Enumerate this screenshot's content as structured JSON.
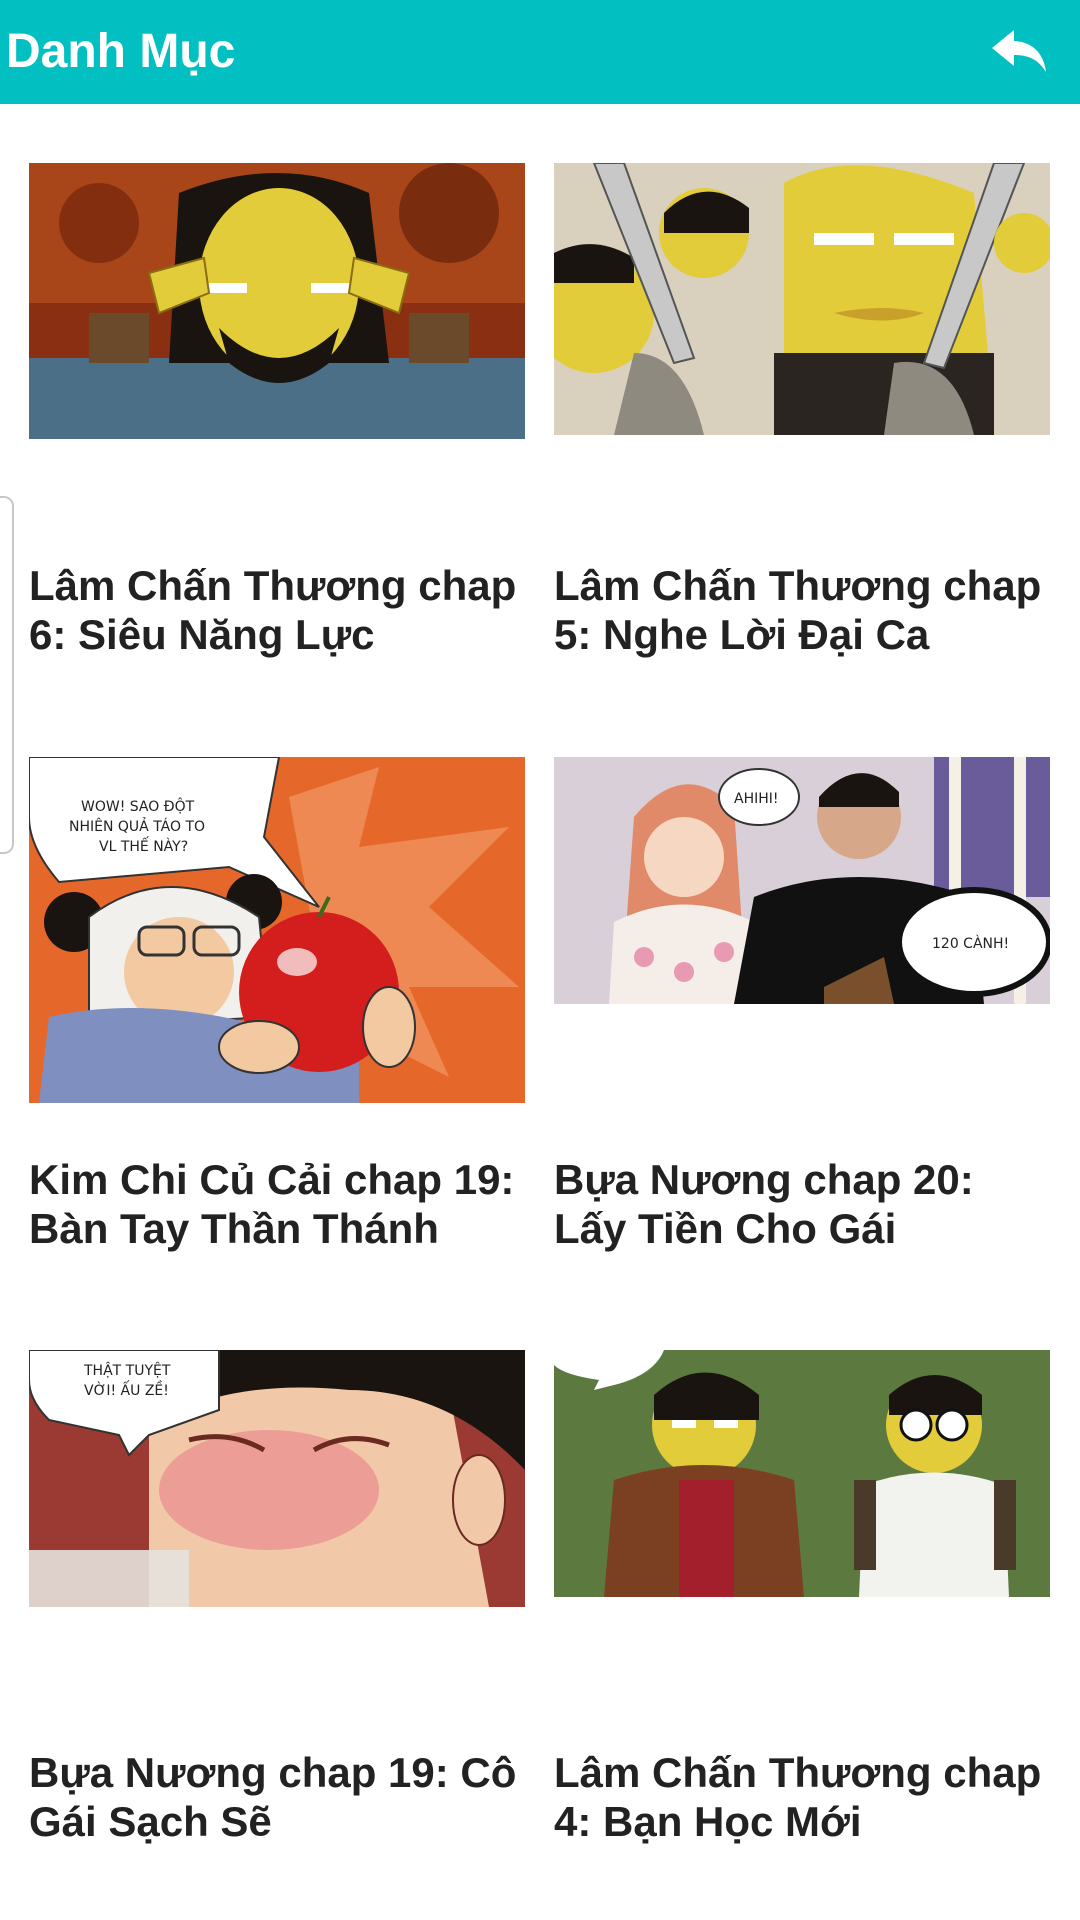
{
  "header": {
    "title": "Danh Mục",
    "background": "#02c0c2",
    "back_icon": "reply-arrow-icon"
  },
  "grid": {
    "items": [
      {
        "title": "Lâm Chấn Thương chap 6: Siêu Năng Lực",
        "thumbnail": "comic-thumbnail"
      },
      {
        "title": "Lâm Chấn Thương chap 5: Nghe Lời Đại Ca",
        "thumbnail": "comic-thumbnail"
      },
      {
        "title": "Kim Chi Củ Cải chap 19: Bàn Tay Thần Thánh",
        "thumbnail": "comic-thumbnail",
        "bubble": [
          "WOW! SAO ĐỘT",
          "NHIÊN QUẢ TÁO TO",
          "VL THẾ NÀY?"
        ]
      },
      {
        "title": "Bựa Nương chap 20: Lấy Tiền Cho Gái",
        "thumbnail": "comic-thumbnail",
        "bubbles": [
          "AHIHI!",
          "120 CÀNH!"
        ]
      },
      {
        "title": "Bựa Nương chap 19: Cô Gái Sạch Sẽ",
        "thumbnail": "comic-thumbnail",
        "bubble": [
          "THẬT TUYỆT",
          "VỜI! ẤU ZỀ!"
        ]
      },
      {
        "title": "Lâm Chấn Thương chap 4: Bạn Học Mới",
        "thumbnail": "comic-thumbnail"
      }
    ]
  }
}
